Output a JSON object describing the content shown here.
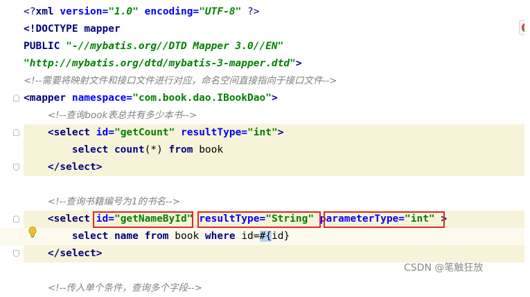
{
  "editor": {
    "lines": [
      {
        "segments": [
          [
            "t-pi",
            "<?"
          ],
          [
            "t-tag",
            "xml "
          ],
          [
            "t-attr",
            "version="
          ],
          [
            "t-dval",
            "\"1.0\" "
          ],
          [
            "t-attr",
            "encoding="
          ],
          [
            "t-dval",
            "\"UTF-8\" "
          ],
          [
            "t-pi",
            "?>"
          ]
        ]
      },
      {
        "segments": [
          [
            "t-tag",
            "<!DOCTYPE "
          ],
          [
            "t-tag",
            "mapper"
          ]
        ]
      },
      {
        "segments": [
          [
            "t-tag",
            "PUBLIC "
          ],
          [
            "t-dval",
            "\"-//mybatis.org//DTD Mapper 3.0//EN\""
          ]
        ]
      },
      {
        "segments": [
          [
            "t-dval",
            "\"http://mybatis.org/dtd/mybatis-3-mapper.dtd\""
          ],
          [
            "t-tag",
            ">"
          ]
        ]
      },
      {
        "segments": [
          [
            "t-cmt",
            "<!--需要将映射文件和接口文件进行对应，命名空间直接指向于接口文件-->"
          ]
        ]
      },
      {
        "segments": [
          [
            "t-tag",
            "<mapper "
          ],
          [
            "t-attr",
            "namespace="
          ],
          [
            "t-val",
            "\"com.book.dao.IBookDao\""
          ],
          [
            "t-tag",
            ">"
          ]
        ]
      },
      {
        "segments": [
          [
            "t-plain",
            "    "
          ],
          [
            "t-cmt",
            "<!--查询book表总共有多少本书-->"
          ]
        ]
      },
      {
        "segments": [
          [
            "t-plain",
            "    "
          ],
          [
            "t-tag",
            "<select "
          ],
          [
            "t-attr",
            "id="
          ],
          [
            "t-val",
            "\"getCount\" "
          ],
          [
            "t-attr",
            "resultType="
          ],
          [
            "t-val",
            "\"int\""
          ],
          [
            "t-tag",
            ">"
          ]
        ]
      },
      {
        "segments": [
          [
            "t-plain",
            "        "
          ],
          [
            "t-kw",
            "select "
          ],
          [
            "t-kw",
            "count"
          ],
          [
            "t-plain",
            "(*) "
          ],
          [
            "t-kw",
            "from "
          ],
          [
            "t-plain",
            "book"
          ]
        ]
      },
      {
        "segments": [
          [
            "t-plain",
            "    "
          ],
          [
            "t-tag",
            "</select>"
          ]
        ]
      },
      {
        "segments": []
      },
      {
        "segments": [
          [
            "t-plain",
            "    "
          ],
          [
            "t-cmt",
            "<!--查询书籍编号为1的书名-->"
          ]
        ]
      },
      {
        "segments": [
          [
            "t-plain",
            "    "
          ],
          [
            "t-tag",
            "<select "
          ],
          [
            "t-attr",
            "id="
          ],
          [
            "t-val",
            "\"getNameById\" "
          ],
          [
            "t-attr",
            "resultType="
          ],
          [
            "t-val",
            "\"String\" "
          ],
          [
            "t-attr",
            "parameterType="
          ],
          [
            "t-val",
            "\"int\" "
          ],
          [
            "t-tag",
            ">"
          ]
        ]
      },
      {
        "segments": [
          [
            "t-plain",
            "        "
          ],
          [
            "t-kw",
            "select "
          ],
          [
            "t-kw",
            "name "
          ],
          [
            "t-kw",
            "from "
          ],
          [
            "t-plain",
            "book "
          ],
          [
            "t-kw",
            "where "
          ],
          [
            "t-plain",
            "id="
          ],
          [
            "t-sel",
            "#{"
          ],
          [
            "t-plain",
            "id}"
          ]
        ]
      },
      {
        "segments": [
          [
            "t-plain",
            "    "
          ],
          [
            "t-tag",
            "</select>"
          ]
        ]
      },
      {
        "segments": []
      },
      {
        "segments": [
          [
            "t-plain",
            "    "
          ],
          [
            "t-cmt",
            "<!--传入单个条件，查询多个字段-->"
          ]
        ]
      }
    ]
  },
  "watermark": "CSDN @笔触狂放",
  "browser_icon": "chrome-icon",
  "intention_icon": "lightbulb-icon"
}
